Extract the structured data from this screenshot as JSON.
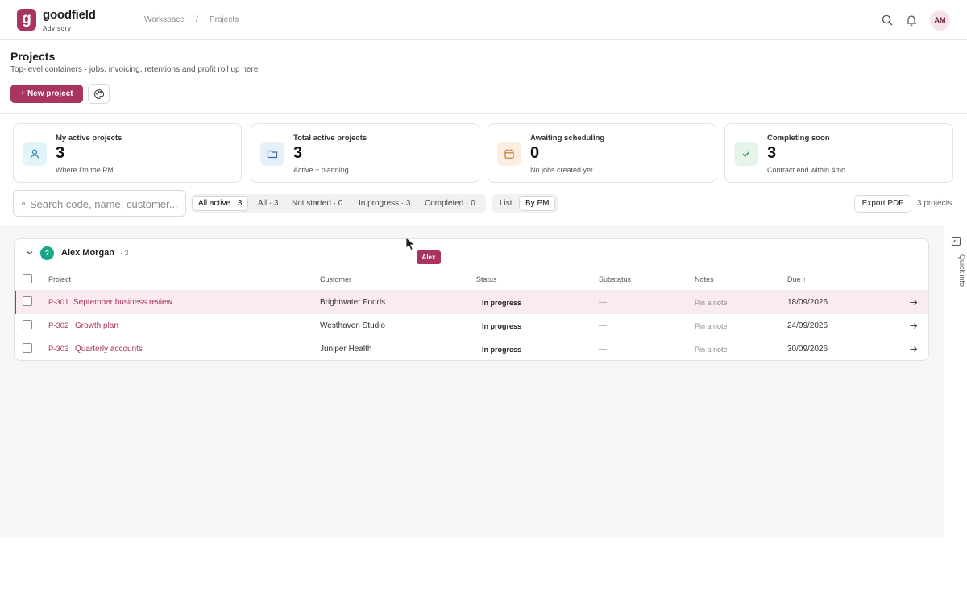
{
  "brand": {
    "mark": "g",
    "name": "goodfield",
    "sub": "Advisory",
    "color": "#a8345f"
  },
  "breadcrumb": {
    "items": [
      "Workspace",
      "Projects"
    ],
    "separator": "/"
  },
  "header": {
    "avatar": "AM",
    "icons": [
      "search-icon",
      "bell-icon"
    ]
  },
  "page": {
    "title": "Projects",
    "subtitle": "Top-level containers · jobs, invoicing, retentions and profit roll up here",
    "new_button": "+ New project"
  },
  "stats": [
    {
      "label": "My active projects",
      "value": "3",
      "note": "Where I'm the PM",
      "icon": "user-icon",
      "tint": "#e3f4f8",
      "stroke": "#2a8aa3"
    },
    {
      "label": "Total active projects",
      "value": "3",
      "note": "Active + planning",
      "icon": "folder-icon",
      "tint": "#e6eef8",
      "stroke": "#3a6ea5"
    },
    {
      "label": "Awaiting scheduling",
      "value": "0",
      "note": "No jobs created yet",
      "icon": "calendar-icon",
      "tint": "#fbeee0",
      "stroke": "#c07a2c"
    },
    {
      "label": "Completing soon",
      "value": "3",
      "note": "Contract end within 4mo",
      "icon": "check-icon",
      "tint": "#e5f5ea",
      "stroke": "#2f8a4e"
    }
  ],
  "filters": {
    "search_placeholder": "Search code, name, customer...",
    "status_tabs": [
      "All active · 3",
      "All · 3",
      "Not started · 0",
      "In progress · 3",
      "Completed · 0"
    ],
    "active_status": "All active · 3",
    "view_tabs": [
      "List",
      "By PM"
    ],
    "active_view": "By PM",
    "export_label": "Export PDF",
    "count_label": "3 projects"
  },
  "group": {
    "initial": "?",
    "name": "Alex Morgan",
    "count": "· 3",
    "columns": [
      "Project",
      "Customer",
      "Status",
      "Substatus",
      "Notes",
      "Due ↑"
    ],
    "rows": [
      {
        "code": "P-301",
        "name": "September business review",
        "customer": "Brightwater Foods",
        "status": "In progress",
        "substatus": "—",
        "notes": "Pin a note",
        "due": "18/09/2026"
      },
      {
        "code": "P-302",
        "name": "Growth plan",
        "customer": "Westhaven Studio",
        "status": "In progress",
        "substatus": "—",
        "notes": "Pin a note",
        "due": "24/09/2026"
      },
      {
        "code": "P-303",
        "name": "Quarterly accounts",
        "customer": "Juniper Health",
        "status": "In progress",
        "substatus": "—",
        "notes": "Pin a note",
        "due": "30/09/2026"
      }
    ]
  },
  "quick_info": "Quick info",
  "tooltip": "Alex"
}
